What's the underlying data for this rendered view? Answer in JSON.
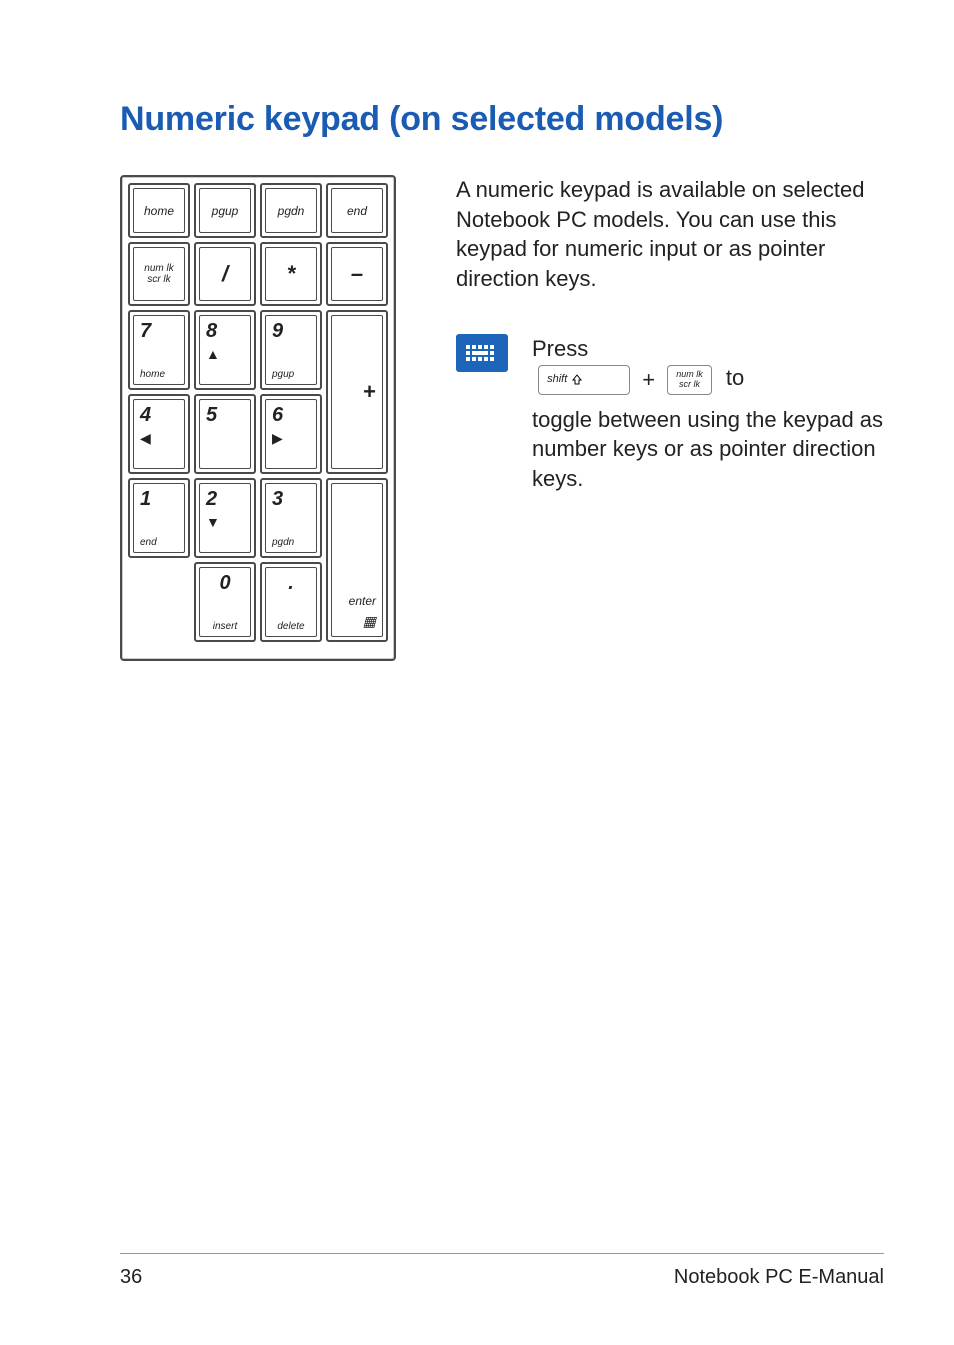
{
  "title": "Numeric keypad (on selected models)",
  "intro": "A numeric keypad is available on selected Notebook PC models. You can use this keypad for numeric input or as pointer direction keys.",
  "tip": {
    "press": "Press",
    "shift_label": "shift",
    "plus": "+",
    "numlk_top": "num lk",
    "numlk_bot": "scr lk",
    "to": "to",
    "rest": "toggle between using the keypad as number keys or as pointer direction keys."
  },
  "keypad": {
    "r1": {
      "home": "home",
      "pgup": "pgup",
      "pgdn": "pgdn",
      "end": "end"
    },
    "r2": {
      "numlk_top": "num lk",
      "numlk_bot": "scr lk",
      "slash": "/",
      "star": "*",
      "minus": "–"
    },
    "r3": {
      "k7": "7",
      "k7s": "home",
      "k8": "8",
      "k8a": "▲",
      "k9": "9",
      "k9s": "pgup"
    },
    "plus": "+",
    "r4": {
      "k4": "4",
      "k4a": "◀",
      "k5": "5",
      "k6": "6",
      "k6a": "▶"
    },
    "r5": {
      "k1": "1",
      "k1s": "end",
      "k2": "2",
      "k2a": "▼",
      "k3": "3",
      "k3s": "pgdn"
    },
    "enter": "enter",
    "enter_icon": "▦",
    "r6": {
      "k0": "0",
      "k0s": "insert",
      "dot": ".",
      "dots": "delete"
    }
  },
  "footer": {
    "page": "36",
    "label": "Notebook PC E-Manual"
  }
}
